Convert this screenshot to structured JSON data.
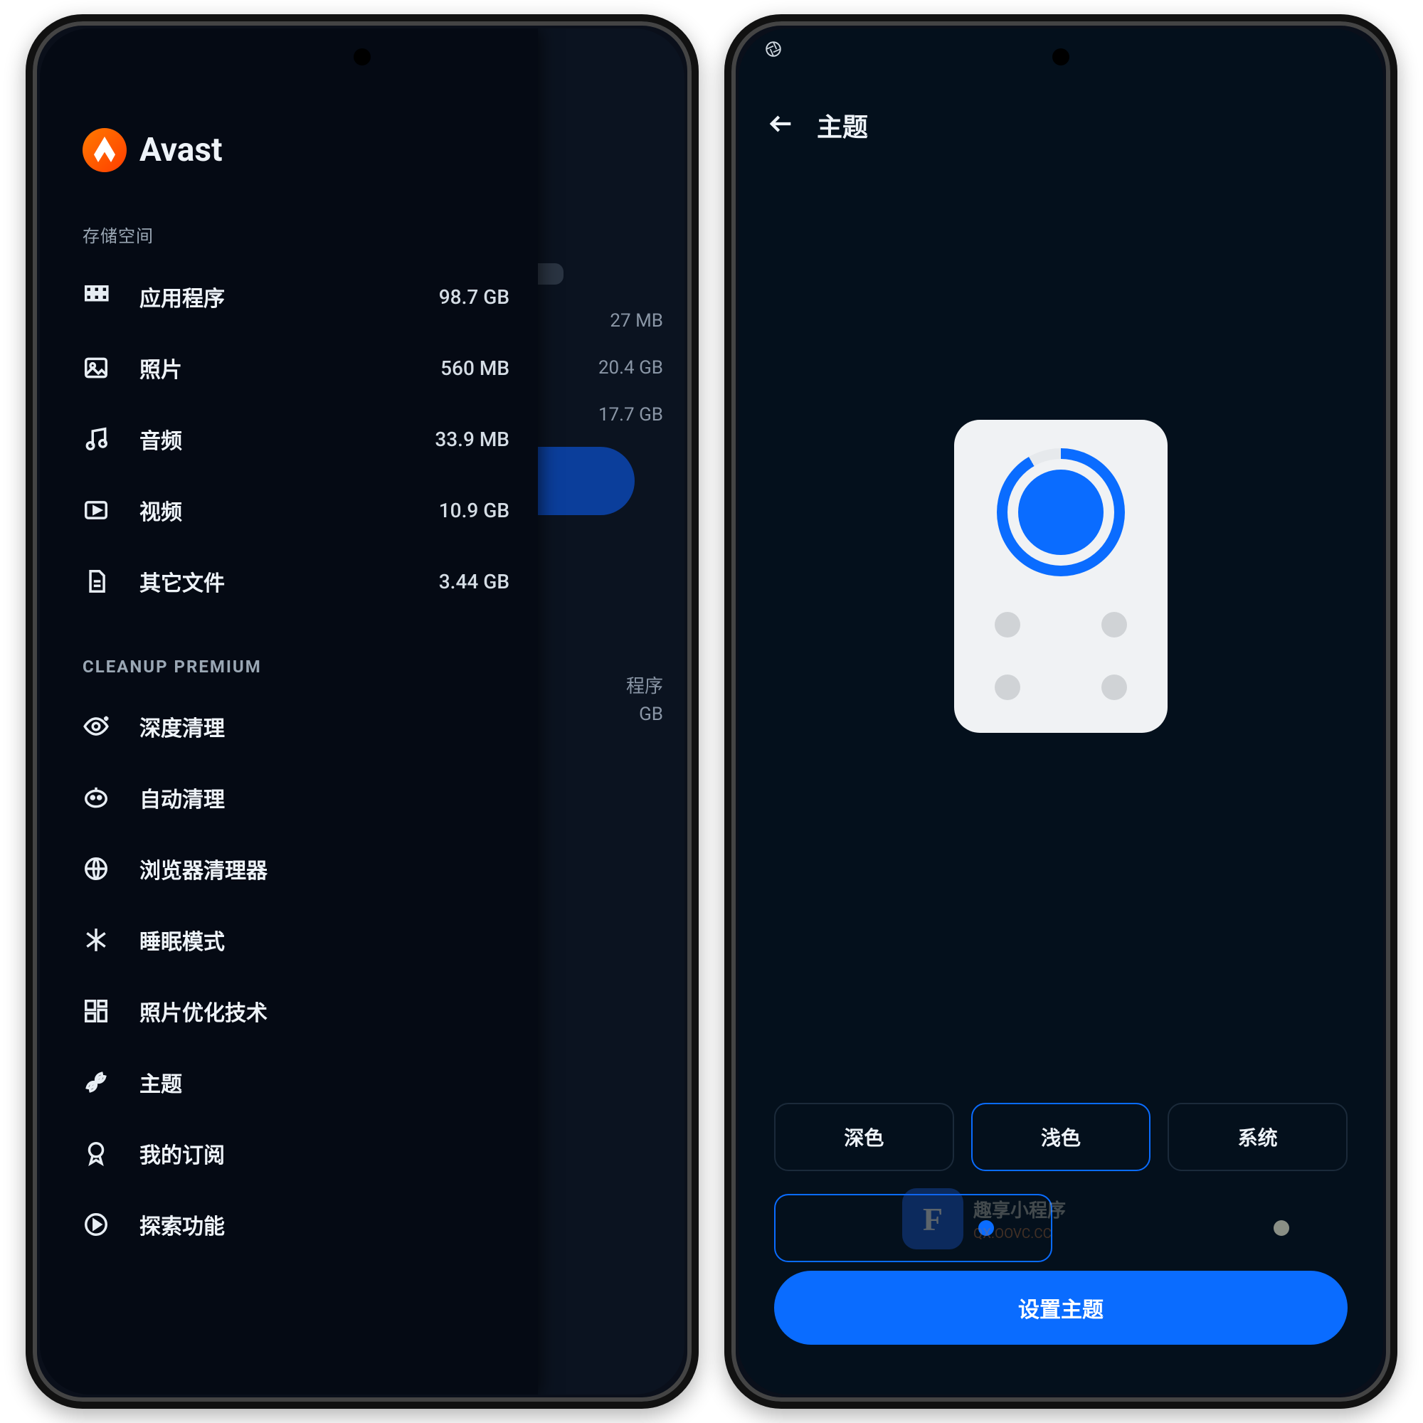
{
  "watermark": {
    "title": "趣享小程序",
    "sub": "QX.OOVC.CC",
    "glyph": "F"
  },
  "left": {
    "brand": "Avast",
    "section_storage": "存储空间",
    "section_premium": "CLEANUP PREMIUM",
    "storage": [
      {
        "label": "应用程序",
        "value": "98.7 GB"
      },
      {
        "label": "照片",
        "value": "560 MB"
      },
      {
        "label": "音频",
        "value": "33.9 MB"
      },
      {
        "label": "视频",
        "value": "10.9 GB"
      },
      {
        "label": "其它文件",
        "value": "3.44 GB"
      }
    ],
    "premium": [
      "深度清理",
      "自动清理",
      "浏览器清理器",
      "睡眠模式",
      "照片优化技术",
      "主题",
      "我的订阅",
      "探索功能"
    ],
    "bg_values": [
      "27 MB",
      "20.4 GB",
      "17.7 GB"
    ],
    "bg_lower": [
      "程序",
      "GB"
    ]
  },
  "right": {
    "title": "主题",
    "options": [
      "深色",
      "浅色",
      "系统"
    ],
    "selected": 1,
    "accents": [
      "#0a6cff",
      "#8a8f85"
    ],
    "selected_accent": 0,
    "primary_btn": "设置主题"
  }
}
